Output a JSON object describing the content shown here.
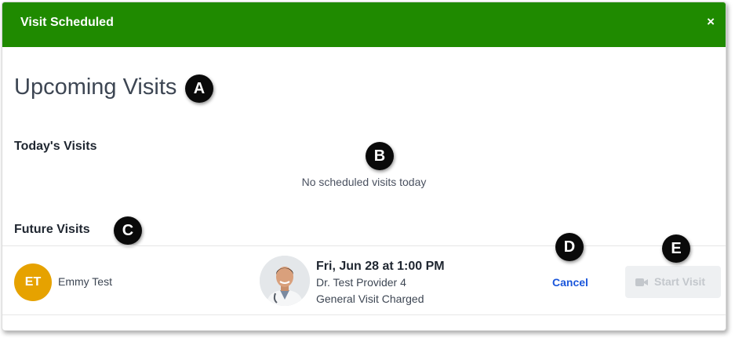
{
  "banner": {
    "title": "Visit Scheduled",
    "close_glyph": "×",
    "color": "#1f8a00"
  },
  "page": {
    "title": "Upcoming Visits"
  },
  "today": {
    "heading": "Today's Visits",
    "empty_text": "No scheduled visits today"
  },
  "future": {
    "heading": "Future Visits",
    "visits": [
      {
        "patient_initials": "ET",
        "patient_name": "Emmy Test",
        "date_time": "Fri, Jun 28 at 1:00 PM",
        "provider": "Dr. Test Provider 4",
        "visit_type": "General Visit Charged",
        "cancel_label": "Cancel",
        "start_label": "Start Visit",
        "start_icon": "video-camera-icon"
      }
    ]
  },
  "callouts": [
    "A",
    "B",
    "C",
    "D",
    "E"
  ],
  "colors": {
    "avatar": "#e6a200",
    "link": "#1a56db",
    "disabled_button": "#eef0f2"
  }
}
